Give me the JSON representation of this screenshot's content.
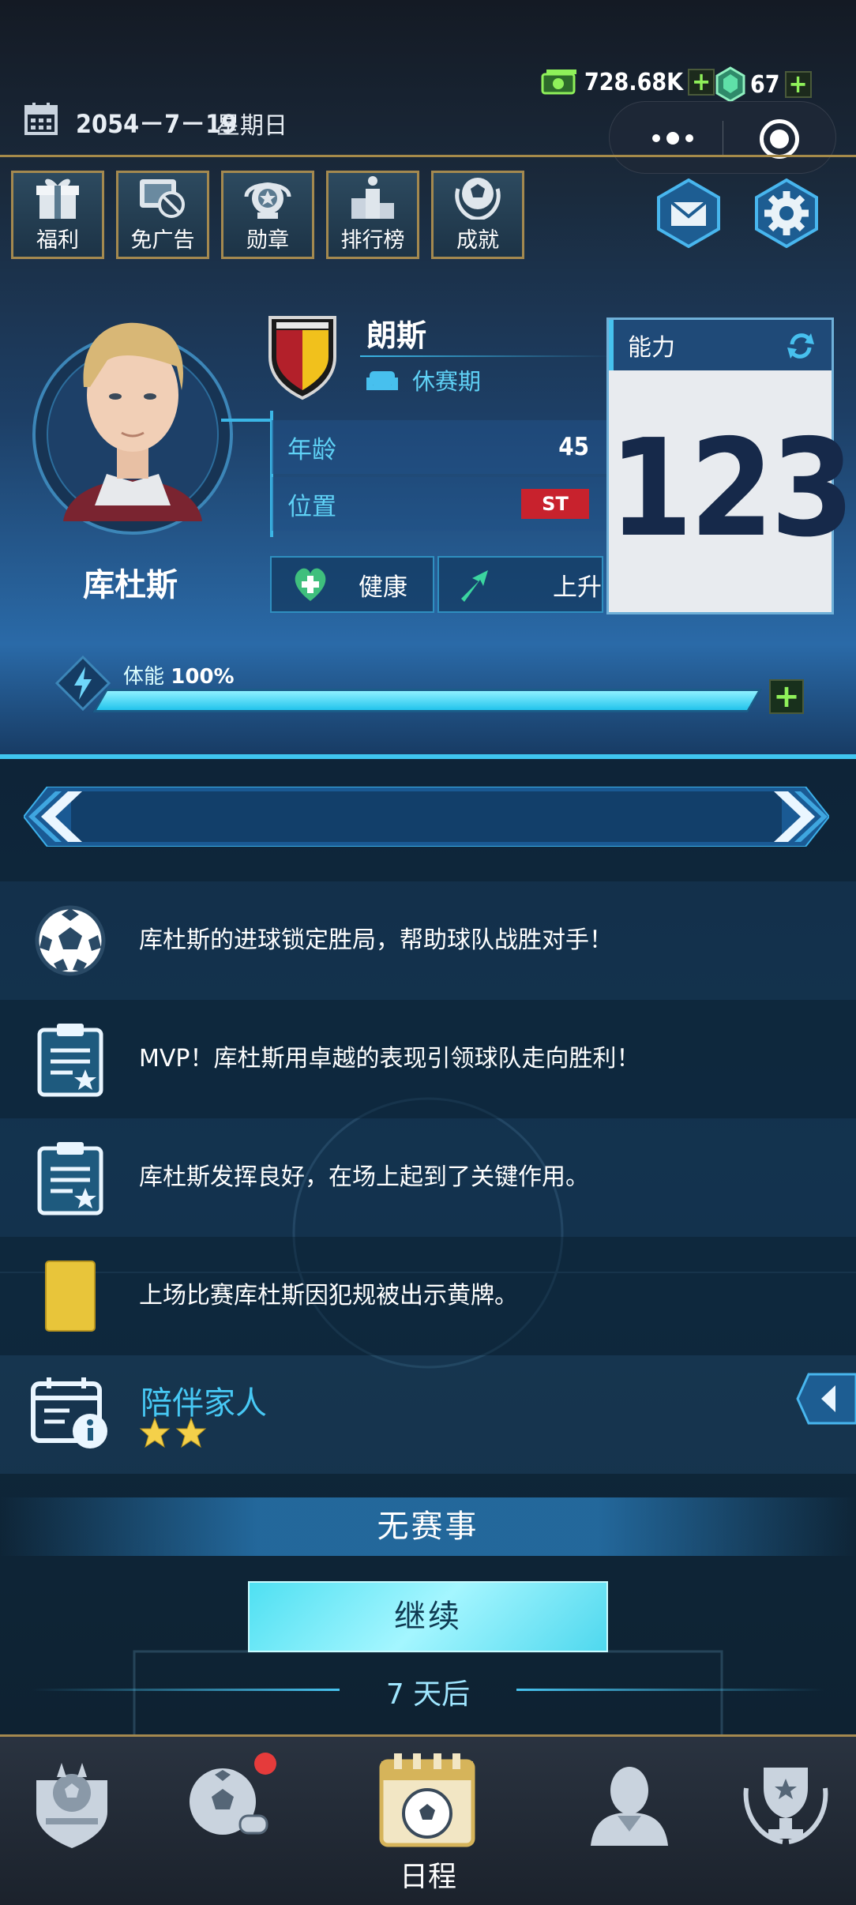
{
  "status": {
    "cash": "728.68K",
    "gems": "67",
    "date": "2054－7－19",
    "weekday": "星期日"
  },
  "toolbar": {
    "items": [
      {
        "label": "福利",
        "icon": "gift-icon"
      },
      {
        "label": "免广告",
        "icon": "no-ads-icon"
      },
      {
        "label": "勋章",
        "icon": "medal-icon"
      },
      {
        "label": "排行榜",
        "icon": "podium-icon"
      },
      {
        "label": "成就",
        "icon": "achievement-icon"
      }
    ],
    "mail_icon": "mail-icon",
    "settings_icon": "gear-icon"
  },
  "player": {
    "name": "库杜斯",
    "team": "朗斯",
    "team_status": "休赛期",
    "age_label": "年龄",
    "age": "45",
    "position_label": "位置",
    "position": "ST",
    "health": "健康",
    "trend": "上升",
    "ability_label": "能力",
    "ability": "123",
    "stamina_label": "体能",
    "stamina_value": "100%",
    "stamina_fraction": 1.0
  },
  "news": [
    {
      "icon": "soccer-ball-icon",
      "text": "库杜斯的进球锁定胜局，帮助球队战胜对手！"
    },
    {
      "icon": "clipboard-star-icon",
      "text": "MVP！库杜斯用卓越的表现引领球队走向胜利！"
    },
    {
      "icon": "clipboard-star-icon",
      "text": "库杜斯发挥良好，在场上起到了关键作用。"
    },
    {
      "icon": "yellow-card-icon",
      "text": "上场比赛库杜斯因犯规被出示黄牌。"
    }
  ],
  "event": {
    "title": "陪伴家人",
    "stars": 2
  },
  "schedule": {
    "status": "无赛事",
    "continue_label": "继续",
    "days_after": "7 天后"
  },
  "nav": {
    "items": [
      {
        "icon": "club-badge-icon",
        "label": ""
      },
      {
        "icon": "ball-whistle-icon",
        "label": ""
      },
      {
        "icon": "calendar-ball-icon",
        "label": "日程"
      },
      {
        "icon": "player-icon",
        "label": ""
      },
      {
        "icon": "trophy-icon",
        "label": ""
      }
    ]
  },
  "colors": {
    "accent": "#3fc6f0",
    "gold_border": "#a4894f",
    "cash_green": "#8ff05a"
  }
}
